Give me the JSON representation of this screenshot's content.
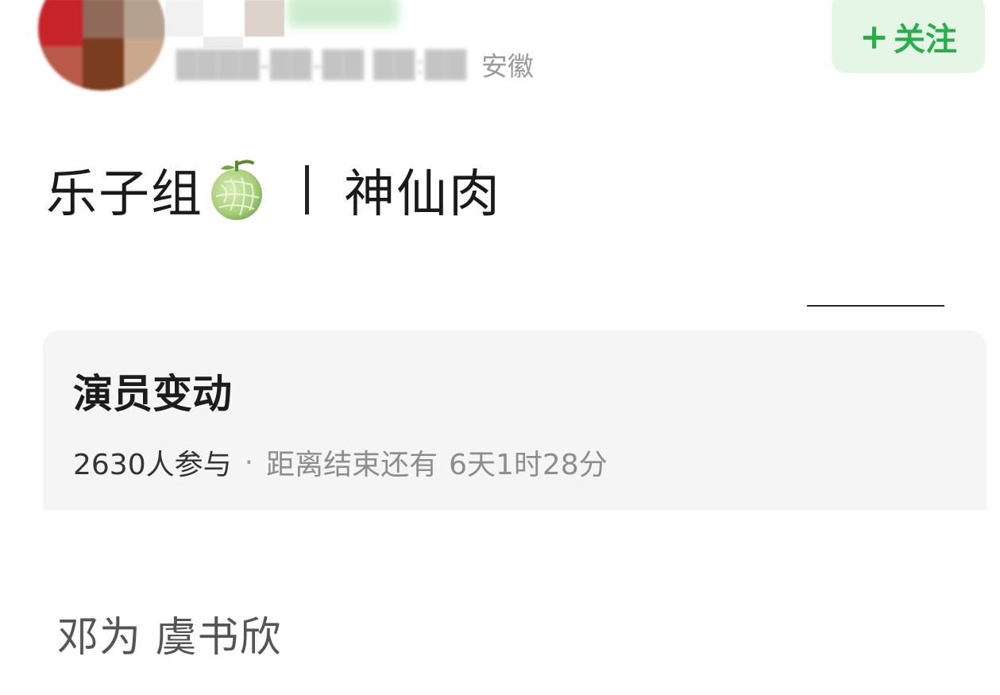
{
  "header": {
    "location": "安徽",
    "follow_label": "关注",
    "follow_plus": "+"
  },
  "post": {
    "title_left": "乐子组",
    "title_icon": "melon-icon",
    "title_right": "神仙肉",
    "body_text": "邓为 虞书欣"
  },
  "vote_card": {
    "title": "演员变动",
    "participants": "2630人参与",
    "separator": "·",
    "countdown_label": "距离结束还有",
    "countdown_value": "6天1时28分"
  },
  "colors": {
    "accent_green": "#2bae4a",
    "follow_bg": "#e5f6e7",
    "card_bg": "#f5f5f5",
    "meta_gray": "#9a9a9a"
  }
}
